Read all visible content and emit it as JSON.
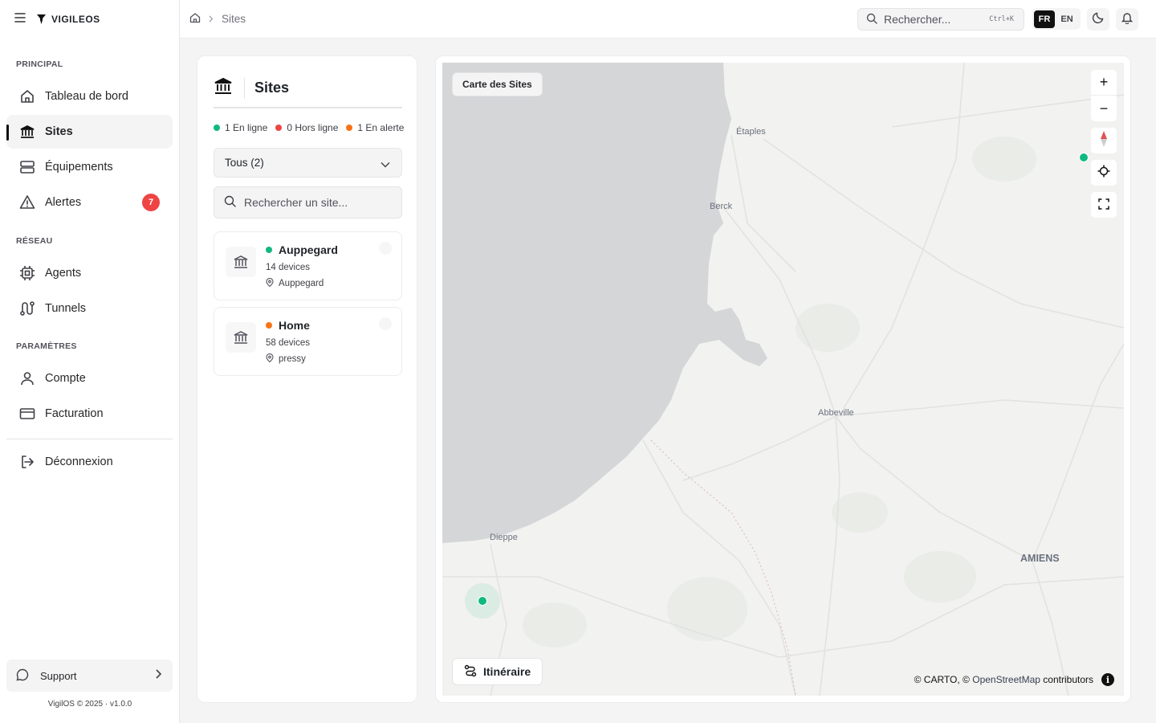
{
  "app": {
    "brand": "VIGILEOS"
  },
  "breadcrumb": {
    "current": "Sites"
  },
  "topbar": {
    "search_placeholder": "Rechercher...",
    "shortcut": "Ctrl+K",
    "lang_fr": "FR",
    "lang_en": "EN"
  },
  "sidebar": {
    "sections": {
      "principal": "PRINCIPAL",
      "reseau": "RÉSEAU",
      "parametres": "PARAMÈTRES"
    },
    "items": {
      "dashboard": "Tableau de bord",
      "sites": "Sites",
      "equipements": "Équipements",
      "alertes": "Alertes",
      "alertes_count": "7",
      "agents": "Agents",
      "tunnels": "Tunnels",
      "compte": "Compte",
      "facturation": "Facturation",
      "logout": "Déconnexion"
    },
    "support": "Support",
    "copyright": "VigilOS © 2025 · v1.0.0"
  },
  "panel": {
    "title": "Sites",
    "status": {
      "online": "1 En ligne",
      "offline": "0 Hors ligne",
      "alert": "1 En alerte"
    },
    "filter": "Tous (2)",
    "search_placeholder": "Rechercher un site...",
    "sites": [
      {
        "name": "Auppegard",
        "devices": "14 devices",
        "location": "Auppegard",
        "status": "online"
      },
      {
        "name": "Home",
        "devices": "58 devices",
        "location": "pressy",
        "status": "alert"
      }
    ]
  },
  "colors": {
    "online": "#10b981",
    "offline": "#ef4444",
    "alert": "#f97316",
    "accent": "#111111"
  },
  "map": {
    "title": "Carte des Sites",
    "cities": {
      "etaples": "Étaples",
      "berck": "Berck",
      "abbeville": "Abbeville",
      "dieppe": "Dieppe",
      "amiens": "AMIENS"
    },
    "route_button": "Itinéraire",
    "attribution": {
      "carto": "© CARTO, ©",
      "osm": "OpenStreetMap",
      "contributors": "contributors"
    },
    "zoom_in": "+",
    "zoom_out": "−"
  }
}
